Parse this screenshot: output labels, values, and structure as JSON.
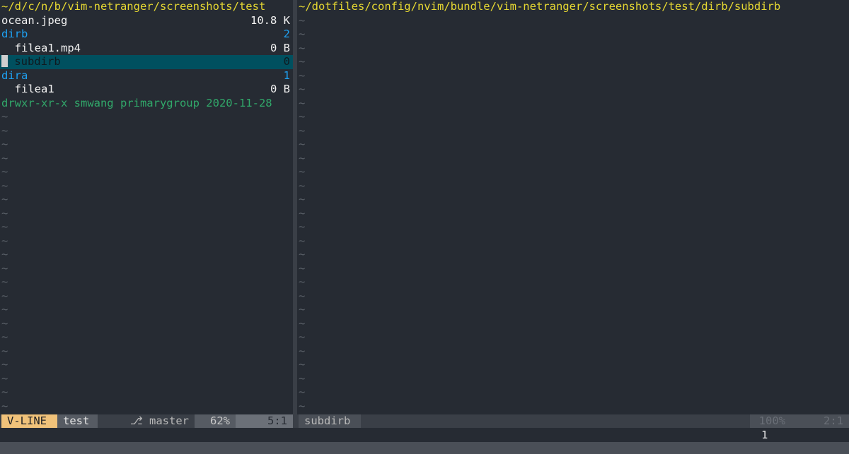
{
  "left_pane": {
    "title": "~/d/c/n/b/vim-netranger/screenshots/test",
    "entries": [
      {
        "name": "ocean.jpeg",
        "meta": "10.8 K",
        "kind": "file"
      },
      {
        "name": "dirb",
        "meta": "2",
        "kind": "dir"
      },
      {
        "name": "  filea1.mp4",
        "meta": "0 B",
        "kind": "file"
      },
      {
        "name": " subdirb",
        "meta": "0",
        "kind": "dir",
        "selected": true
      },
      {
        "name": "dira",
        "meta": "1",
        "kind": "dir"
      },
      {
        "name": "  filea1",
        "meta": "0 B",
        "kind": "file"
      }
    ],
    "info": "drwxr-xr-x smwang primarygroup 2020-11-28",
    "tilde": "~"
  },
  "right_pane": {
    "title": "~/dotfiles/config/nvim/bundle/vim-netranger/screenshots/test/dirb/subdirb",
    "tilde": "~"
  },
  "status_left": {
    "mode": "V-LINE",
    "name": "test",
    "branch": "⎇ master",
    "percent": "62%",
    "position": "5:1"
  },
  "status_right": {
    "name": "subdirb",
    "percent": "100%",
    "position": "2:1"
  },
  "cmdline": {
    "count": "1"
  },
  "colors": {
    "background": "#262b33",
    "title": "#e6d832",
    "directory": "#1ea1f2",
    "info": "#31a86a",
    "selection": "#00505f",
    "mode_bg": "#f0c27a"
  }
}
